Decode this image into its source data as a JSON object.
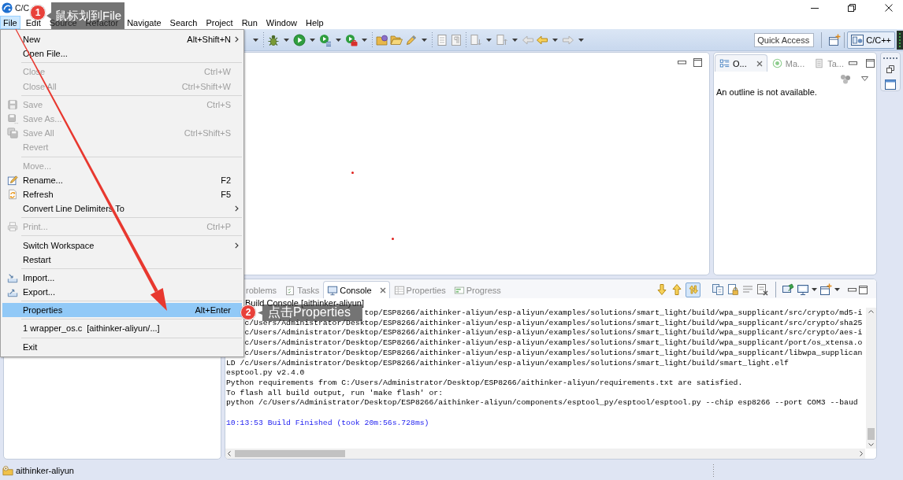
{
  "window": {
    "title": "C/C"
  },
  "menu_bar": [
    {
      "label": "File",
      "selected": true
    },
    {
      "label": "Edit",
      "selected": false
    },
    {
      "label": "Source",
      "selected": false
    },
    {
      "label": "Refactor",
      "selected": false
    },
    {
      "label": "Navigate",
      "selected": false
    },
    {
      "label": "Search",
      "selected": false
    },
    {
      "label": "Project",
      "selected": false
    },
    {
      "label": "Run",
      "selected": false
    },
    {
      "label": "Window",
      "selected": false
    },
    {
      "label": "Help",
      "selected": false
    }
  ],
  "toolbar": {
    "quick_access": {
      "placeholder": "Quick Access"
    },
    "perspective": {
      "label": "C/C++",
      "selected": true
    }
  },
  "outline_panel": {
    "tabs": [
      {
        "label": "O...",
        "selected": true
      },
      {
        "label": "Ma...",
        "selected": false
      },
      {
        "label": "Ta...",
        "selected": false
      }
    ],
    "message": "An outline is not available."
  },
  "console_panel": {
    "tabs": [
      {
        "label": "roblems",
        "selected": false
      },
      {
        "label": "Tasks",
        "selected": false
      },
      {
        "label": "Console",
        "selected": true
      },
      {
        "label": "Properties",
        "selected": false
      },
      {
        "label": "Progress",
        "selected": false
      }
    ],
    "toolbar_toggle": {
      "on": true
    },
    "title": "Build Console [aithinker-aliyun]",
    "lines": [
      {
        "kind": "output",
        "text": "top/ESP8266/aithinker-aliyun/esp-aliyun/examples/solutions/smart_light/build/wpa_supplicant/src/crypto/md5-i"
      },
      {
        "kind": "output",
        "text": "c/Users/Administrator/Desktop/ESP8266/aithinker-aliyun/esp-aliyun/examples/solutions/smart_light/build/wpa_supplicant/src/crypto/sha25"
      },
      {
        "kind": "output",
        "text": "c/Users/Administrator/Desktop/ESP8266/aithinker-aliyun/esp-aliyun/examples/solutions/smart_light/build/wpa_supplicant/src/crypto/aes-i"
      },
      {
        "kind": "output",
        "text": "c/Users/Administrator/Desktop/ESP8266/aithinker-aliyun/esp-aliyun/examples/solutions/smart_light/build/wpa_supplicant/port/os_xtensa.o"
      },
      {
        "kind": "output",
        "text": "c/Users/Administrator/Desktop/ESP8266/aithinker-aliyun/esp-aliyun/examples/solutions/smart_light/build/wpa_supplicant/libwpa_supplican"
      },
      {
        "kind": "output",
        "text": "LD /c/Users/Administrator/Desktop/ESP8266/aithinker-aliyun/esp-aliyun/examples/solutions/smart_light/build/smart_light.elf"
      },
      {
        "kind": "output",
        "text": "esptool.py v2.4.0"
      },
      {
        "kind": "output",
        "text": "Python requirements from C:/Users/Administrator/Desktop/ESP8266/aithinker-aliyun/requirements.txt are satisfied."
      },
      {
        "kind": "output",
        "text": "To flash all build output, run 'make flash' or:"
      },
      {
        "kind": "output",
        "text": "python /c/Users/Administrator/Desktop/ESP8266/aithinker-aliyun/components/esptool_py/esptool/esptool.py --chip esp8266 --port COM3 --baud"
      },
      {
        "kind": "status",
        "text": "10:13:53 Build Finished (took 20m:56s.728ms)"
      }
    ]
  },
  "status_bar": {
    "project": "aithinker-aliyun"
  },
  "file_menu": [
    {
      "kind": "item",
      "label": "New",
      "shortcut": "Alt+Shift+N",
      "submenu": true,
      "disabled": false,
      "selected": false
    },
    {
      "kind": "item",
      "label": "Open File...",
      "submenu": false,
      "disabled": false,
      "selected": false
    },
    {
      "kind": "separator"
    },
    {
      "kind": "item",
      "label": "Close",
      "shortcut": "Ctrl+W",
      "submenu": false,
      "disabled": true,
      "selected": false
    },
    {
      "kind": "item",
      "label": "Close All",
      "shortcut": "Ctrl+Shift+W",
      "submenu": false,
      "disabled": true,
      "selected": false
    },
    {
      "kind": "separator"
    },
    {
      "kind": "item",
      "label": "Save",
      "shortcut": "Ctrl+S",
      "submenu": false,
      "disabled": true,
      "selected": false
    },
    {
      "kind": "item",
      "label": "Save As...",
      "submenu": false,
      "disabled": true,
      "selected": false
    },
    {
      "kind": "item",
      "label": "Save All",
      "shortcut": "Ctrl+Shift+S",
      "submenu": false,
      "disabled": true,
      "selected": false
    },
    {
      "kind": "item",
      "label": "Revert",
      "submenu": false,
      "disabled": true,
      "selected": false
    },
    {
      "kind": "separator"
    },
    {
      "kind": "item",
      "label": "Move...",
      "submenu": false,
      "disabled": true,
      "selected": false
    },
    {
      "kind": "item",
      "label": "Rename...",
      "shortcut": "F2",
      "submenu": false,
      "disabled": false,
      "selected": false
    },
    {
      "kind": "item",
      "label": "Refresh",
      "shortcut": "F5",
      "submenu": false,
      "disabled": false,
      "selected": false
    },
    {
      "kind": "item",
      "label": "Convert Line Delimiters To",
      "submenu": true,
      "disabled": false,
      "selected": false
    },
    {
      "kind": "separator"
    },
    {
      "kind": "item",
      "label": "Print...",
      "shortcut": "Ctrl+P",
      "submenu": false,
      "disabled": true,
      "selected": false
    },
    {
      "kind": "separator"
    },
    {
      "kind": "item",
      "label": "Switch Workspace",
      "submenu": true,
      "disabled": false,
      "selected": false
    },
    {
      "kind": "item",
      "label": "Restart",
      "submenu": false,
      "disabled": false,
      "selected": false
    },
    {
      "kind": "separator"
    },
    {
      "kind": "item",
      "label": "Import...",
      "submenu": false,
      "disabled": false,
      "selected": false
    },
    {
      "kind": "item",
      "label": "Export...",
      "submenu": false,
      "disabled": false,
      "selected": false
    },
    {
      "kind": "separator"
    },
    {
      "kind": "item",
      "label": "Properties",
      "shortcut": "Alt+Enter",
      "submenu": false,
      "disabled": false,
      "selected": true
    },
    {
      "kind": "separator"
    },
    {
      "kind": "item",
      "label": "1 wrapper_os.c  [aithinker-aliyun/...]",
      "submenu": false,
      "disabled": false,
      "selected": false
    },
    {
      "kind": "separator"
    },
    {
      "kind": "item",
      "label": "Exit",
      "submenu": false,
      "disabled": false,
      "selected": false
    }
  ],
  "annotations": [
    {
      "number": "1",
      "text": "鼠标划到File"
    },
    {
      "number": "2",
      "text": "点击Properties"
    }
  ]
}
